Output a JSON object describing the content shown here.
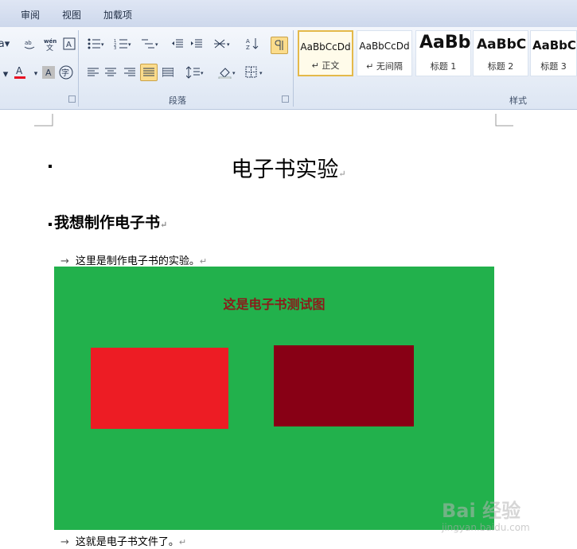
{
  "tabs": [
    "审阅",
    "视图",
    "加载项"
  ],
  "ribbon": {
    "paragraph_label": "段落",
    "styles_label": "样式",
    "font_prefix": "a",
    "font_color": "#e81123",
    "styles": [
      {
        "sample": "AaBbCcDd",
        "name": "↵ 正文",
        "selected": true
      },
      {
        "sample": "AaBbCcDd",
        "name": "↵ 无间隔"
      },
      {
        "sample": "AaBb",
        "name": "标题 1"
      },
      {
        "sample": "AaBbC",
        "name": "标题 2"
      },
      {
        "sample": "AaBbC",
        "name": "标题 3"
      }
    ]
  },
  "document": {
    "title": "电子书实验",
    "heading": "我想制作电子书",
    "line1": "这里是制作电子书的实验。",
    "line2": "这就是电子书文件了。",
    "para_mark": "↵",
    "arrow": "→"
  },
  "figure": {
    "title": "这是电子书测试图",
    "background": "#22b14c",
    "title_color": "#8b1a1a",
    "rect1_color": "#ed1c24",
    "rect2_color": "#880015"
  },
  "watermark": {
    "brand": "Bai 经验",
    "url": "jingyan.baidu.com"
  }
}
